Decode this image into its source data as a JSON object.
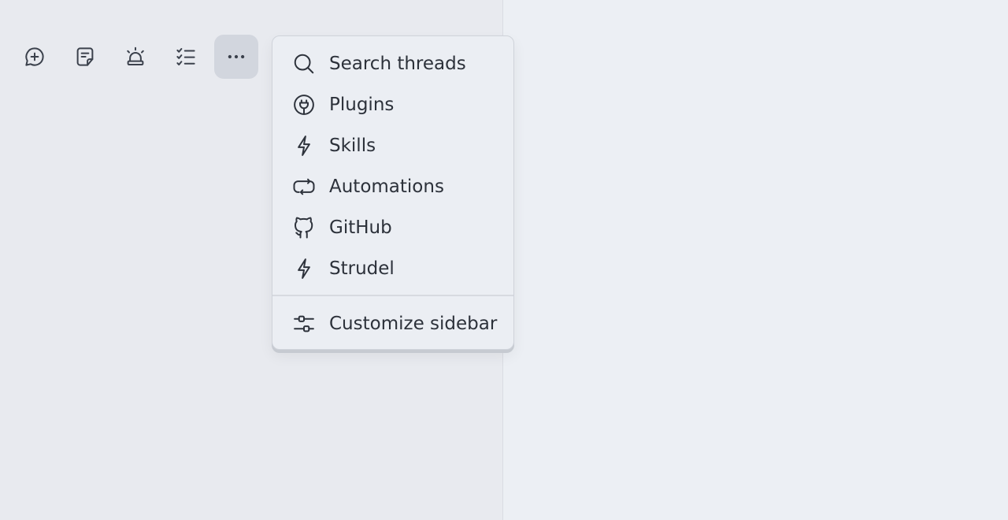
{
  "toolbar": {
    "buttons": [
      {
        "icon": "chat-plus-icon"
      },
      {
        "icon": "note-icon"
      },
      {
        "icon": "alarm-icon"
      },
      {
        "icon": "checklist-icon"
      },
      {
        "icon": "more-dots-icon",
        "active": true
      }
    ]
  },
  "menu": {
    "items": [
      {
        "label": "Search threads",
        "icon": "search-icon"
      },
      {
        "label": "Plugins",
        "icon": "plug-icon"
      },
      {
        "label": "Skills",
        "icon": "bolt-icon"
      },
      {
        "label": "Automations",
        "icon": "repeat-icon"
      },
      {
        "label": "GitHub",
        "icon": "github-icon"
      },
      {
        "label": "Strudel",
        "icon": "bolt-icon"
      }
    ],
    "footer_item": {
      "label": "Customize sidebar",
      "icon": "sliders-icon"
    }
  },
  "colors": {
    "sidebar_bg": "#e8eaef",
    "main_bg": "#eceff4",
    "menu_bg": "#ebeef3",
    "active_button_bg": "#d2d6de",
    "text": "#2c313a"
  }
}
